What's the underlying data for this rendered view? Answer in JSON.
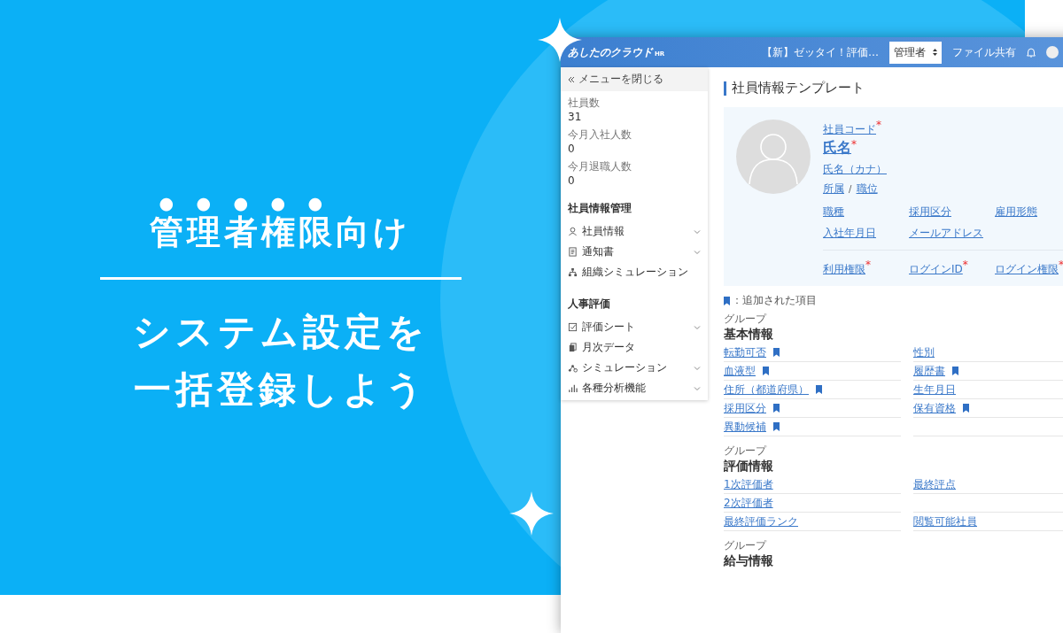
{
  "banner": {
    "headline": [
      {
        "text": "管理者権限",
        "emphasis": true
      },
      {
        "text": "向け",
        "emphasis": false
      }
    ],
    "subtitle_lines": [
      "システム設定を",
      "一括登録しよう"
    ]
  },
  "app": {
    "logo": "あしたのクラウド",
    "logo_suffix": "HR",
    "header": {
      "notice": "【新】ゼッタイ！評価…",
      "role_select": "管理者",
      "file_share": "ファイル共有"
    },
    "sidebar": {
      "close_menu": "メニューを閉じる",
      "stats": [
        {
          "label": "社員数",
          "value": "31"
        },
        {
          "label": "今月入社人数",
          "value": "0"
        },
        {
          "label": "今月退職人数",
          "value": "0"
        }
      ],
      "sections": [
        {
          "title": "社員情報管理",
          "items": [
            {
              "label": "社員情報",
              "expandable": true
            },
            {
              "label": "通知書",
              "expandable": true
            },
            {
              "label": "組織シミュレーション",
              "expandable": false
            }
          ]
        },
        {
          "title": "人事評価",
          "items": [
            {
              "label": "評価シート",
              "expandable": true
            },
            {
              "label": "月次データ",
              "expandable": false
            },
            {
              "label": "シミュレーション",
              "expandable": true
            },
            {
              "label": "各種分析機能",
              "expandable": true
            }
          ]
        }
      ]
    },
    "main": {
      "title": "社員情報テンプレート",
      "profile": {
        "employee_code": {
          "label": "社員コード",
          "mark": "*"
        },
        "name": {
          "label": "氏名",
          "mark": "*"
        },
        "name_kana": "氏名（カナ）",
        "department": "所属",
        "separator": "/",
        "position": "職位",
        "fields": [
          {
            "label": "職種"
          },
          {
            "label": "採用区分"
          },
          {
            "label": "雇用形態"
          },
          {
            "label": "入社年月日"
          },
          {
            "label": "メールアドレス"
          }
        ],
        "login_fields": [
          {
            "label": "利用権限",
            "mark": "*"
          },
          {
            "label": "ログインID",
            "mark": "*"
          },
          {
            "label": "ログイン権限",
            "mark": "*"
          }
        ]
      },
      "legend": "：追加された項目",
      "groups": [
        {
          "caption": "グループ",
          "title": "基本情報",
          "rows": [
            {
              "cells": [
                {
                  "label": "転勤可否",
                  "added": true
                },
                {
                  "label": "性別",
                  "added": false
                }
              ]
            },
            {
              "cells": [
                {
                  "label": "血液型",
                  "added": true
                },
                {
                  "label": "履歴書",
                  "added": true
                }
              ]
            },
            {
              "cells": [
                {
                  "label": "住所（都道府県）",
                  "added": true
                },
                {
                  "label": "生年月日",
                  "added": false
                }
              ]
            },
            {
              "cells": [
                {
                  "label": "採用区分",
                  "added": true
                },
                {
                  "label": "保有資格",
                  "added": true
                }
              ]
            },
            {
              "cells": [
                {
                  "label": "異動候補",
                  "added": true
                }
              ]
            }
          ]
        },
        {
          "caption": "グループ",
          "title": "評価情報",
          "rows": [
            {
              "cells": [
                {
                  "label": "1次評価者",
                  "added": false
                },
                {
                  "label": "最終評点",
                  "added": false
                }
              ]
            },
            {
              "cells": [
                {
                  "label": "2次評価者",
                  "added": false
                }
              ]
            },
            {
              "cells": [
                {
                  "label": "最終評価ランク",
                  "added": false
                },
                {
                  "label": "閲覧可能社員",
                  "added": false
                }
              ]
            }
          ]
        },
        {
          "caption": "グループ",
          "title": "給与情報"
        }
      ]
    }
  }
}
